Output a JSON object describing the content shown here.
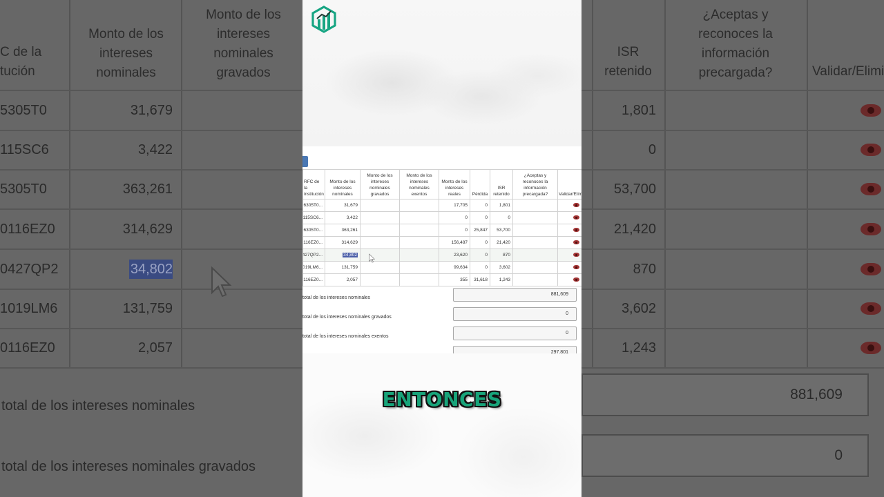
{
  "headers": {
    "rfc": "RFC de la institución",
    "nominales": "Monto de los intereses nominales",
    "gravados": "Monto de los intereses nominales gravados",
    "exentos": "Monto de los intereses nominales exentos",
    "reales": "Monto de los intereses reales",
    "perdida": "Pérdida",
    "isr": "ISR retenido",
    "aceptas": "¿Aceptas y reconoces la información precargada?",
    "validar": "Validar/Eliminar"
  },
  "rows": [
    {
      "rfc": "...6305T0",
      "nominales": "31,679",
      "reales": "17,705",
      "perdida": "0",
      "isr": "1,801"
    },
    {
      "rfc": "...115SC6",
      "nominales": "3,422",
      "reales": "0",
      "perdida": "0",
      "isr": "0"
    },
    {
      "rfc": "...6305T0",
      "nominales": "363,261",
      "reales": "0",
      "perdida": "25,847",
      "isr": "53,700"
    },
    {
      "rfc": "...0116EZ0",
      "nominales": "314,629",
      "reales": "156,487",
      "perdida": "0",
      "isr": "21,420"
    },
    {
      "rfc": "...0427QP2",
      "nominales": "34,802",
      "reales": "23,620",
      "perdida": "0",
      "isr": "870"
    },
    {
      "rfc": "...1019LM6",
      "nominales": "131,759",
      "reales": "99,634",
      "perdida": "0",
      "isr": "3,602"
    },
    {
      "rfc": "...0116EZ0",
      "nominales": "2,057",
      "reales": "355",
      "perdida": "31,618",
      "isr": "1,243"
    }
  ],
  "totals": {
    "nominales_label": "Monto total de los intereses nominales",
    "nominales_value": "881,609",
    "gravados_label": "Monto total de los intereses nominales gravados",
    "gravados_value": "0",
    "exentos_label": "Monto total de los intereses nominales exentos",
    "exentos_value": "0",
    "reales_value": "297,801"
  },
  "caption": "ENTONCES",
  "colors": {
    "accent": "#18a47a",
    "eye": "#a23535",
    "selection": "#4a5ea8",
    "button": "#4a78b4"
  },
  "icons": {
    "logo": "bar-chart-logo-icon",
    "row_action": "eye-icon",
    "pointer": "mouse-cursor-icon"
  }
}
